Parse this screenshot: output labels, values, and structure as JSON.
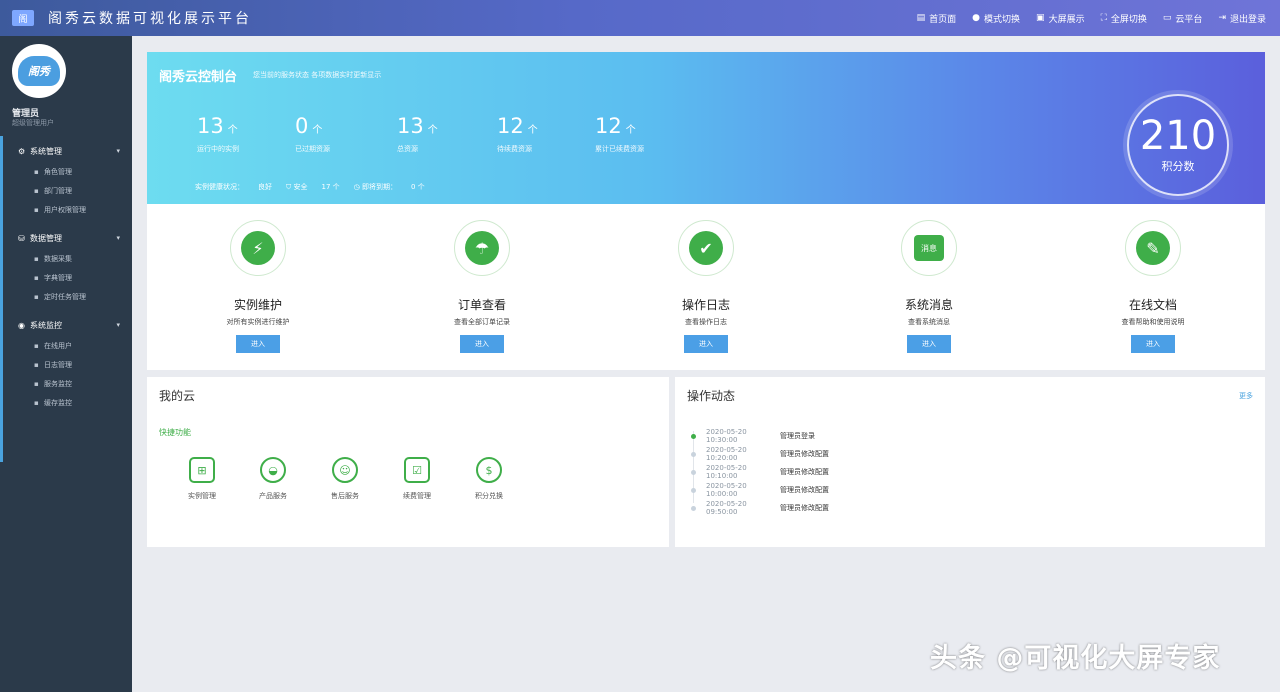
{
  "header": {
    "badge": "阁",
    "title": "阁秀云数据可视化展示平台",
    "nav": [
      {
        "icon": "grid-icon",
        "glyph": "▤",
        "label": "首页面"
      },
      {
        "icon": "dot-icon",
        "glyph": "●",
        "label": "模式切换"
      },
      {
        "icon": "monitor-icon",
        "glyph": "▣",
        "label": "大屏展示"
      },
      {
        "icon": "expand-icon",
        "glyph": "⛶",
        "label": "全屏切换"
      },
      {
        "icon": "screen-icon",
        "glyph": "▭",
        "label": "云平台"
      },
      {
        "icon": "exit-icon",
        "glyph": "⇥",
        "label": "退出登录"
      }
    ]
  },
  "sidebar": {
    "logo_text": "阁秀",
    "user_name": "管理员",
    "user_sub": "超级管理用户",
    "groups": [
      {
        "label": "系统管理",
        "icon": "gear-icon",
        "glyph": "⚙",
        "chevron": "▾",
        "items": [
          {
            "label": "角色管理",
            "glyph": "▪"
          },
          {
            "label": "部门管理",
            "glyph": "▪"
          },
          {
            "label": "用户权限管理",
            "glyph": "▪"
          }
        ]
      },
      {
        "label": "数据管理",
        "icon": "database-icon",
        "glyph": "⛁",
        "chevron": "▾",
        "items": [
          {
            "label": "数据采集",
            "glyph": "▪"
          },
          {
            "label": "字典管理",
            "glyph": "▪"
          },
          {
            "label": "定时任务管理",
            "glyph": "▪"
          }
        ]
      },
      {
        "label": "系统监控",
        "icon": "monitor-icon",
        "glyph": "◉",
        "chevron": "▾",
        "items": [
          {
            "label": "在线用户",
            "glyph": "▪"
          },
          {
            "label": "日志管理",
            "glyph": "▪"
          },
          {
            "label": "服务监控",
            "glyph": "▪"
          },
          {
            "label": "缓存监控",
            "glyph": "▪"
          }
        ]
      }
    ]
  },
  "hero": {
    "title": "阁秀云控制台",
    "subtitle": "您当前的服务状态    各项数据实时更新显示",
    "stats": [
      {
        "value": "13",
        "unit": "个",
        "label": "运行中的实例"
      },
      {
        "value": "0",
        "unit": "个",
        "label": "已过期资源"
      },
      {
        "value": "13",
        "unit": "个",
        "label": "总资源"
      },
      {
        "value": "12",
        "unit": "个",
        "label": "待续费资源"
      },
      {
        "value": "12",
        "unit": "个",
        "label": "累计已续费资源"
      }
    ],
    "status_items": [
      "实例健康状况：",
      "良好",
      "⛉ 安全",
      "17  个",
      "◷ 即将到期：",
      "0  个"
    ],
    "score_value": "210",
    "score_label": "积分数"
  },
  "features": [
    {
      "icon": "lightning-icon",
      "glyph": "⚡",
      "name": "实例维护",
      "desc": "对所有实例进行维护",
      "btn": "进入"
    },
    {
      "icon": "umbrella-icon",
      "glyph": "☂",
      "name": "订单查看",
      "desc": "查看全部订单记录",
      "btn": "进入"
    },
    {
      "icon": "shield-icon",
      "glyph": "✔",
      "name": "操作日志",
      "desc": "查看操作日志",
      "btn": "进入"
    },
    {
      "icon": "notice-icon",
      "glyph": "消息",
      "name": "系统消息",
      "desc": "查看系统消息",
      "btn": "进入"
    },
    {
      "icon": "document-edit-icon",
      "glyph": "✎",
      "name": "在线文档",
      "desc": "查看帮助和使用说明",
      "btn": "进入"
    }
  ],
  "mycloud": {
    "title": "我的云",
    "quick_label": "快捷功能",
    "items": [
      {
        "icon": "server-icon",
        "glyph": "⊞",
        "label": "实例管理",
        "round": false
      },
      {
        "icon": "helmet-icon",
        "glyph": "◒",
        "label": "产品服务",
        "round": true
      },
      {
        "icon": "support-icon",
        "glyph": "☺",
        "label": "售后服务",
        "round": true
      },
      {
        "icon": "checklist-icon",
        "glyph": "☑",
        "label": "续费管理",
        "round": false
      },
      {
        "icon": "money-bag-icon",
        "glyph": "$",
        "label": "积分兑换",
        "round": true
      }
    ]
  },
  "activity": {
    "title": "操作动态",
    "more": "更多",
    "rows": [
      {
        "time": "2020-05-20 10:30:00",
        "text": "管理员登录"
      },
      {
        "time": "2020-05-20 10:20:00",
        "text": "管理员修改配置"
      },
      {
        "time": "2020-05-20 10:10:00",
        "text": "管理员修改配置"
      },
      {
        "time": "2020-05-20 10:00:00",
        "text": "管理员修改配置"
      },
      {
        "time": "2020-05-20 09:50:00",
        "text": "管理员修改配置"
      }
    ]
  },
  "watermark": "头条 @可视化大屏专家",
  "colors": {
    "accent_green": "#3fae49",
    "accent_blue": "#4b9fe6",
    "sidebar_bg": "#2b3a4a",
    "header_start": "#3d5a9c",
    "header_end": "#6f74d8"
  }
}
